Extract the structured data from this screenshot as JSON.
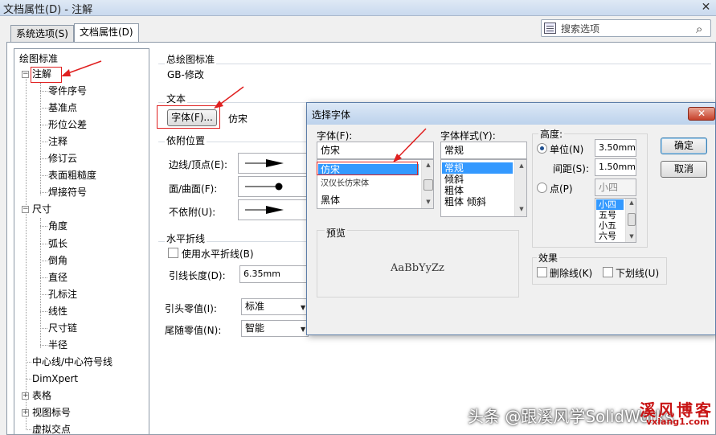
{
  "window": {
    "title": "文档属性(D) - 注解",
    "close_glyph": "✕"
  },
  "tabs": [
    {
      "label": "系统选项(S)",
      "active": false
    },
    {
      "label": "文档属性(D)",
      "active": true
    }
  ],
  "search": {
    "placeholder": "搜索选项"
  },
  "tree": {
    "root": "绘图标准",
    "items": [
      {
        "label": "注解",
        "level": 1,
        "expander": "−"
      },
      {
        "label": "零件序号",
        "level": 2
      },
      {
        "label": "基准点",
        "level": 2
      },
      {
        "label": "形位公差",
        "level": 2
      },
      {
        "label": "注释",
        "level": 2
      },
      {
        "label": "修订云",
        "level": 2
      },
      {
        "label": "表面粗糙度",
        "level": 2
      },
      {
        "label": "焊接符号",
        "level": 2
      },
      {
        "label": "尺寸",
        "level": 1,
        "expander": "−"
      },
      {
        "label": "角度",
        "level": 2
      },
      {
        "label": "弧长",
        "level": 2
      },
      {
        "label": "倒角",
        "level": 2
      },
      {
        "label": "直径",
        "level": 2
      },
      {
        "label": "孔标注",
        "level": 2
      },
      {
        "label": "线性",
        "level": 2
      },
      {
        "label": "尺寸链",
        "level": 2
      },
      {
        "label": "半径",
        "level": 2
      },
      {
        "label": "中心线/中心符号线",
        "level": 1
      },
      {
        "label": "DimXpert",
        "level": 1
      },
      {
        "label": "表格",
        "level": 1,
        "expander": "+"
      },
      {
        "label": "视图标号",
        "level": 1,
        "expander": "+"
      },
      {
        "label": "虚拟交点",
        "level": 1
      }
    ]
  },
  "main": {
    "overall_standard_label": "总绘图标准",
    "overall_standard_value": "GB-修改",
    "text_group_label": "文本",
    "font_button_label": "字体(F)...",
    "font_value": "仿宋",
    "attachment_group_label": "依附位置",
    "attach_edge_label": "边线/顶点(E):",
    "attach_face_label": "面/曲面(F):",
    "attach_none_label": "不依附(U):",
    "bent_leader_group_label": "水平折线",
    "use_bent_leader_label": "使用水平折线(B)",
    "leader_length_label": "引线长度(D):",
    "leader_length_value": "6.35mm",
    "leading_zeros_label": "引头零值(I):",
    "leading_zeros_value": "标准",
    "trailing_zeros_label": "尾随零值(N):",
    "trailing_zeros_value": "智能"
  },
  "dialog": {
    "title": "选择字体",
    "close_glyph": "✕",
    "font_label": "字体(F):",
    "font_input": "仿宋",
    "font_list": [
      "仿宋",
      "汉仪长仿宋体",
      "黑体"
    ],
    "font_selected": "仿宋",
    "style_label": "字体样式(Y):",
    "style_input": "常规",
    "style_list": [
      "常规",
      "倾斜",
      "粗体",
      "粗体 倾斜"
    ],
    "style_selected": "常规",
    "height_label": "高度:",
    "unit_label": "单位(N)",
    "unit_value": "3.50mm",
    "spacing_label": "间距(S):",
    "spacing_value": "1.50mm",
    "point_label": "点(P)",
    "point_value": "小四",
    "point_list": [
      "小四",
      "五号",
      "小五",
      "六号"
    ],
    "point_selected": "小四",
    "ok_label": "确定",
    "cancel_label": "取消",
    "preview_label": "预览",
    "preview_text": "AaBbYyZz",
    "effects_label": "效果",
    "strikeout_label": "删除线(K)",
    "underline_label": "下划线(U)"
  },
  "watermark": {
    "text": "头条 @跟溪风学SolidWorks",
    "logo_text": "溪风博客",
    "logo_url": "vxiang1.com"
  },
  "colors": {
    "annotation_red": "#e02020",
    "selection_blue": "#3399ff"
  }
}
